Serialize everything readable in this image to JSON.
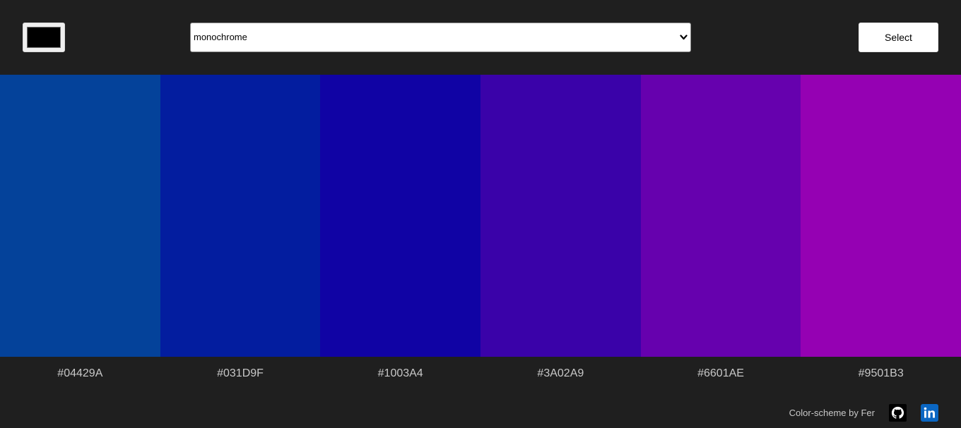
{
  "header": {
    "seed_color": "#000000",
    "mode_select": {
      "value": "monochrome"
    },
    "select_button_label": "Select"
  },
  "palette": {
    "colors": [
      {
        "hex": "#04429A",
        "label": "#04429A"
      },
      {
        "hex": "#031D9F",
        "label": "#031D9F"
      },
      {
        "hex": "#1003A4",
        "label": "#1003A4"
      },
      {
        "hex": "#3A02A9",
        "label": "#3A02A9"
      },
      {
        "hex": "#6601AE",
        "label": "#6601AE"
      },
      {
        "hex": "#9501B3",
        "label": "#9501B3"
      }
    ]
  },
  "footer": {
    "credit": "Color-scheme by Fer",
    "links": [
      {
        "icon": "github-icon"
      },
      {
        "icon": "linkedin-icon"
      }
    ]
  },
  "theme": {
    "background": "#1F1F1F",
    "label_color": "#C8C8C8",
    "linkedin_brand": "#0A66C2"
  }
}
